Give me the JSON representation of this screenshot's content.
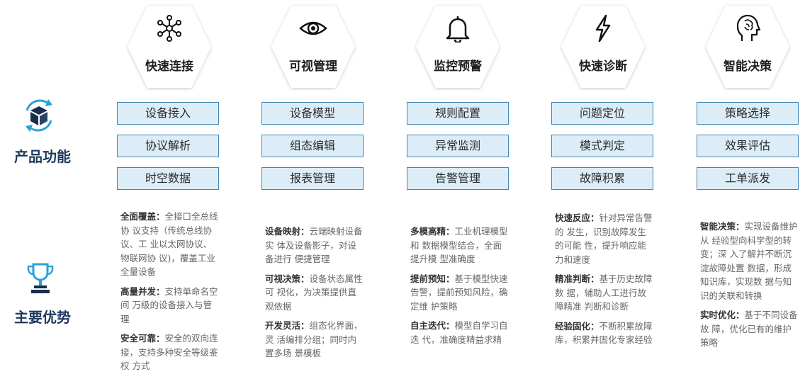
{
  "left": {
    "features_label": "产品功能",
    "advantages_label": "主要优势"
  },
  "columns": [
    {
      "title": "快速连接",
      "icon": "network-icon",
      "buttons": [
        "设备接入",
        "协议解析",
        "时空数据"
      ],
      "advantages": [
        {
          "label": "全面覆盖：",
          "text": "全接口全总线协 议支持（传统总线协议、工 业以太网协议、物联网协 议)，覆盖工业全量设备"
        },
        {
          "label": "高量并发：",
          "text": "支持单命名空间 万级的设备接入与管理"
        },
        {
          "label": "安全可靠：",
          "text": "安全的双向连 接，支持多种安全等级鉴权 方式"
        }
      ]
    },
    {
      "title": "可视管理",
      "icon": "eye-icon",
      "buttons": [
        "设备模型",
        "组态编辑",
        "报表管理"
      ],
      "advantages": [
        {
          "label": "设备映射：",
          "text": "云端映射设备实 体及设备影子，对设备进行 便捷管理"
        },
        {
          "label": "可视决策：",
          "text": "设备状态属性可 视化，为决策提供直观依据"
        },
        {
          "label": "开发灵活：",
          "text": "组态化界面，灵 活编排分组；同时内置多场 景模板"
        }
      ]
    },
    {
      "title": "监控预警",
      "icon": "bell-icon",
      "buttons": [
        "规则配置",
        "异常监测",
        "告警管理"
      ],
      "advantages": [
        {
          "label": "多模高精：",
          "text": "工业机理模型和 数据模型结合，全面提升模 型准确度"
        },
        {
          "label": "提前预知：",
          "text": "基于模型快速告警，提前预知风险，确定维 护策略"
        },
        {
          "label": "自主迭代：",
          "text": "模型自学习自迭 代，准确度精益求精"
        }
      ]
    },
    {
      "title": "快速诊断",
      "icon": "lightning-icon",
      "buttons": [
        "问题定位",
        "模式判定",
        "故障积累"
      ],
      "advantages": [
        {
          "label": "快速反应：",
          "text": "针对异常告警的 发生，识别故障发生的可能 性，提升响应能力和速度"
        },
        {
          "label": "精准判断：",
          "text": "基于历史故障数 据，辅助人工进行故障精准 判断和诊断"
        },
        {
          "label": "经验固化：",
          "text": "不断积累故障 库，积累并固化专家经验"
        }
      ]
    },
    {
      "title": "智能决策",
      "icon": "brain-head-icon",
      "buttons": [
        "策略选择",
        "效果评估",
        "工单派发"
      ],
      "advantages": [
        {
          "label": "智能决策：",
          "text": "实现设备维护从 经验型向科学型的转变；深 入了解并不断沉淀故障处置 数据，形成知识库，实现数 据与知识的关联和转换"
        },
        {
          "label": "实时优化：",
          "text": "基于不同设备故 障，优化已有的维护策略"
        }
      ]
    }
  ]
}
